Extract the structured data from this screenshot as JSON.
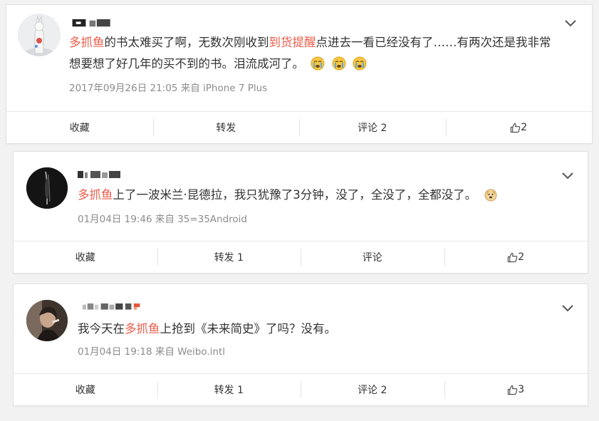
{
  "posts": [
    {
      "segments": [
        {
          "text": "多抓鱼",
          "hl": true
        },
        {
          "text": "的书太难买了啊，无数次刚收到",
          "hl": false
        },
        {
          "text": "到货提醒",
          "hl": true
        },
        {
          "text": "点进去一看已经没有了……有两次还是我非常",
          "hl": false
        }
      ],
      "line2": "想要想了好几年的买不到的书。泪流成河了。",
      "meta": "2017年09月26日 21:05 来自 iPhone 7 Plus",
      "actions": {
        "fav": "收藏",
        "repost": "转发",
        "comment": "评论 2",
        "like": "2"
      }
    },
    {
      "segments": [
        {
          "text": "多抓鱼",
          "hl": true
        },
        {
          "text": "上了一波米兰·昆德拉，我只犹豫了3分钟，没了，全没了，全都没了。",
          "hl": false
        }
      ],
      "meta": "01月04日 19:46 来自 35=35Android",
      "actions": {
        "fav": "收藏",
        "repost": "转发 1",
        "comment": "评论",
        "like": "2"
      }
    },
    {
      "segments": [
        {
          "text": "我今天在",
          "hl": false
        },
        {
          "text": "多抓鱼",
          "hl": true
        },
        {
          "text": "上抢到《未来简史》了吗？没有。",
          "hl": false
        }
      ],
      "meta": "01月04日 19:18 来自 Weibo.intl",
      "actions": {
        "fav": "收藏",
        "repost": "转发 1",
        "comment": "评论 2",
        "like": "3"
      }
    }
  ],
  "icons": {
    "more": "chevron-down-icon",
    "like": "thumbs-up-icon",
    "crying": "crying-emoji",
    "dog": "dog-emoji"
  },
  "colors": {
    "highlight": "#eb5d4b",
    "meta": "#8c8c8c",
    "background": "#f2f2f2"
  }
}
